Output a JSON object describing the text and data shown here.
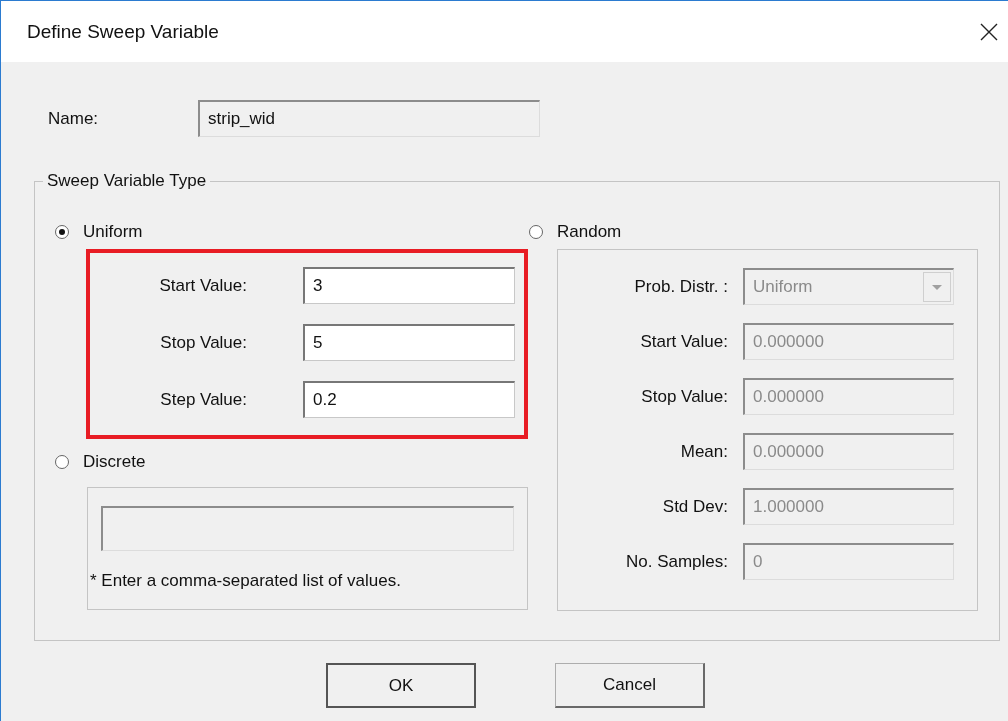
{
  "window": {
    "title": "Define Sweep Variable"
  },
  "name": {
    "label": "Name:",
    "value": "strip_wid",
    "disabled": true
  },
  "group": {
    "title": "Sweep Variable Type"
  },
  "uniform": {
    "label": "Uniform",
    "selected": true,
    "highlighted": true,
    "disabled": false,
    "fields": [
      {
        "label": "Start Value:",
        "value": "3"
      },
      {
        "label": "Stop Value:",
        "value": "5"
      },
      {
        "label": "Step Value:",
        "value": "0.2"
      }
    ]
  },
  "discrete": {
    "label": "Discrete",
    "selected": false,
    "disabled": true,
    "note": "* Enter a comma-separated list of values."
  },
  "random": {
    "label": "Random",
    "selected": false,
    "disabled": true,
    "dropdown": {
      "label": "Prob. Distr. :",
      "value": "Uniform"
    },
    "fields": [
      {
        "label": "Start Value:",
        "value": "0.000000"
      },
      {
        "label": "Stop Value:",
        "value": "0.000000"
      },
      {
        "label": "Mean:",
        "value": "0.000000"
      },
      {
        "label": "Std Dev:",
        "value": "1.000000"
      },
      {
        "label": "No.  Samples:",
        "value": "0"
      }
    ]
  },
  "buttons": [
    {
      "label": "OK",
      "default": true
    },
    {
      "label": "Cancel",
      "default": false
    }
  ]
}
